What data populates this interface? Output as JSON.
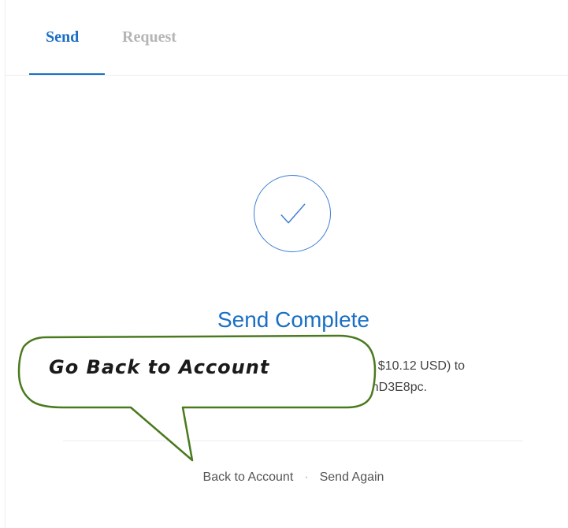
{
  "tabs": [
    {
      "label": "Send",
      "active": true
    },
    {
      "label": "Request",
      "active": false
    }
  ],
  "status": {
    "icon": "checkmark-icon",
    "title": "Send Complete",
    "description_line1": "th $10.12 USD) to",
    "description_line2": "ZnD3E8pc."
  },
  "footer": {
    "back_label": "Back to Account",
    "separator": "·",
    "again_label": "Send Again"
  },
  "callout": {
    "text": "Go Back to Account"
  },
  "colors": {
    "accent": "#1a6fc4",
    "inactive_tab": "#b5b5b5",
    "callout_border": "#4a7a1e"
  }
}
